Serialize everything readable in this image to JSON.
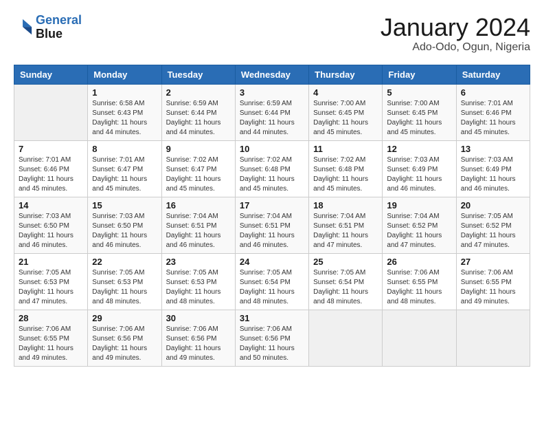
{
  "header": {
    "logo": {
      "line1": "General",
      "line2": "Blue"
    },
    "title": "January 2024",
    "subtitle": "Ado-Odo, Ogun, Nigeria"
  },
  "weekdays": [
    "Sunday",
    "Monday",
    "Tuesday",
    "Wednesday",
    "Thursday",
    "Friday",
    "Saturday"
  ],
  "weeks": [
    [
      {
        "day": "",
        "info": ""
      },
      {
        "day": "1",
        "info": "Sunrise: 6:58 AM\nSunset: 6:43 PM\nDaylight: 11 hours\nand 44 minutes."
      },
      {
        "day": "2",
        "info": "Sunrise: 6:59 AM\nSunset: 6:44 PM\nDaylight: 11 hours\nand 44 minutes."
      },
      {
        "day": "3",
        "info": "Sunrise: 6:59 AM\nSunset: 6:44 PM\nDaylight: 11 hours\nand 44 minutes."
      },
      {
        "day": "4",
        "info": "Sunrise: 7:00 AM\nSunset: 6:45 PM\nDaylight: 11 hours\nand 45 minutes."
      },
      {
        "day": "5",
        "info": "Sunrise: 7:00 AM\nSunset: 6:45 PM\nDaylight: 11 hours\nand 45 minutes."
      },
      {
        "day": "6",
        "info": "Sunrise: 7:01 AM\nSunset: 6:46 PM\nDaylight: 11 hours\nand 45 minutes."
      }
    ],
    [
      {
        "day": "7",
        "info": "Sunrise: 7:01 AM\nSunset: 6:46 PM\nDaylight: 11 hours\nand 45 minutes."
      },
      {
        "day": "8",
        "info": "Sunrise: 7:01 AM\nSunset: 6:47 PM\nDaylight: 11 hours\nand 45 minutes."
      },
      {
        "day": "9",
        "info": "Sunrise: 7:02 AM\nSunset: 6:47 PM\nDaylight: 11 hours\nand 45 minutes."
      },
      {
        "day": "10",
        "info": "Sunrise: 7:02 AM\nSunset: 6:48 PM\nDaylight: 11 hours\nand 45 minutes."
      },
      {
        "day": "11",
        "info": "Sunrise: 7:02 AM\nSunset: 6:48 PM\nDaylight: 11 hours\nand 45 minutes."
      },
      {
        "day": "12",
        "info": "Sunrise: 7:03 AM\nSunset: 6:49 PM\nDaylight: 11 hours\nand 46 minutes."
      },
      {
        "day": "13",
        "info": "Sunrise: 7:03 AM\nSunset: 6:49 PM\nDaylight: 11 hours\nand 46 minutes."
      }
    ],
    [
      {
        "day": "14",
        "info": "Sunrise: 7:03 AM\nSunset: 6:50 PM\nDaylight: 11 hours\nand 46 minutes."
      },
      {
        "day": "15",
        "info": "Sunrise: 7:03 AM\nSunset: 6:50 PM\nDaylight: 11 hours\nand 46 minutes."
      },
      {
        "day": "16",
        "info": "Sunrise: 7:04 AM\nSunset: 6:51 PM\nDaylight: 11 hours\nand 46 minutes."
      },
      {
        "day": "17",
        "info": "Sunrise: 7:04 AM\nSunset: 6:51 PM\nDaylight: 11 hours\nand 46 minutes."
      },
      {
        "day": "18",
        "info": "Sunrise: 7:04 AM\nSunset: 6:51 PM\nDaylight: 11 hours\nand 47 minutes."
      },
      {
        "day": "19",
        "info": "Sunrise: 7:04 AM\nSunset: 6:52 PM\nDaylight: 11 hours\nand 47 minutes."
      },
      {
        "day": "20",
        "info": "Sunrise: 7:05 AM\nSunset: 6:52 PM\nDaylight: 11 hours\nand 47 minutes."
      }
    ],
    [
      {
        "day": "21",
        "info": "Sunrise: 7:05 AM\nSunset: 6:53 PM\nDaylight: 11 hours\nand 47 minutes."
      },
      {
        "day": "22",
        "info": "Sunrise: 7:05 AM\nSunset: 6:53 PM\nDaylight: 11 hours\nand 48 minutes."
      },
      {
        "day": "23",
        "info": "Sunrise: 7:05 AM\nSunset: 6:53 PM\nDaylight: 11 hours\nand 48 minutes."
      },
      {
        "day": "24",
        "info": "Sunrise: 7:05 AM\nSunset: 6:54 PM\nDaylight: 11 hours\nand 48 minutes."
      },
      {
        "day": "25",
        "info": "Sunrise: 7:05 AM\nSunset: 6:54 PM\nDaylight: 11 hours\nand 48 minutes."
      },
      {
        "day": "26",
        "info": "Sunrise: 7:06 AM\nSunset: 6:55 PM\nDaylight: 11 hours\nand 48 minutes."
      },
      {
        "day": "27",
        "info": "Sunrise: 7:06 AM\nSunset: 6:55 PM\nDaylight: 11 hours\nand 49 minutes."
      }
    ],
    [
      {
        "day": "28",
        "info": "Sunrise: 7:06 AM\nSunset: 6:55 PM\nDaylight: 11 hours\nand 49 minutes."
      },
      {
        "day": "29",
        "info": "Sunrise: 7:06 AM\nSunset: 6:56 PM\nDaylight: 11 hours\nand 49 minutes."
      },
      {
        "day": "30",
        "info": "Sunrise: 7:06 AM\nSunset: 6:56 PM\nDaylight: 11 hours\nand 49 minutes."
      },
      {
        "day": "31",
        "info": "Sunrise: 7:06 AM\nSunset: 6:56 PM\nDaylight: 11 hours\nand 50 minutes."
      },
      {
        "day": "",
        "info": ""
      },
      {
        "day": "",
        "info": ""
      },
      {
        "day": "",
        "info": ""
      }
    ]
  ]
}
